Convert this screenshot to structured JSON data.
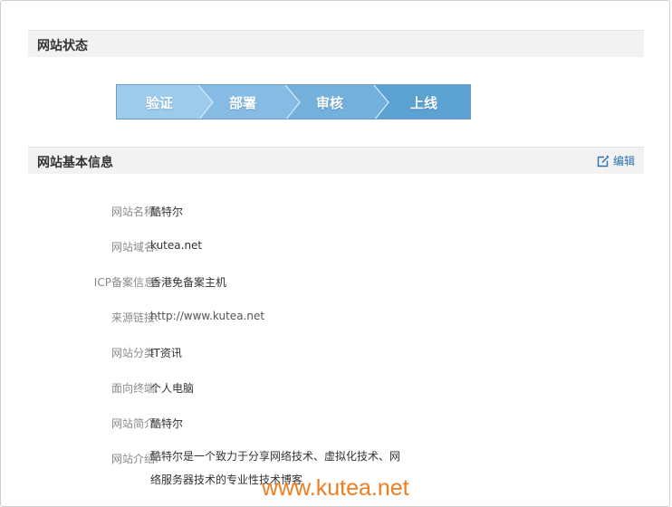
{
  "status_section": {
    "title": "网站状态",
    "steps": [
      "验证",
      "部署",
      "审核",
      "上线"
    ],
    "colors": [
      "#9ccbec",
      "#86bce3",
      "#74b0dc",
      "#5ba2d3"
    ]
  },
  "basic_section": {
    "title": "网站基本信息",
    "edit_label": "编辑",
    "rows": [
      {
        "label": "网站名称:",
        "value": "酷特尔"
      },
      {
        "label": "网站域名:",
        "value": "kutea.net"
      },
      {
        "label": "ICP备案信息:",
        "value": "香港免备案主机"
      },
      {
        "label": "来源链接:",
        "value": "http://www.kutea.net"
      },
      {
        "label": "网站分类:",
        "value": "IT资讯"
      },
      {
        "label": "面向终端:",
        "value": "个人电脑"
      },
      {
        "label": "网站简介:",
        "value": "酷特尔"
      },
      {
        "label": "网站介绍:",
        "value": "酷特尔是一个致力于分享网络技术、虚拟化技术、网络服务器技术的专业性技术博客"
      }
    ]
  },
  "watermark": "www.kutea.net"
}
